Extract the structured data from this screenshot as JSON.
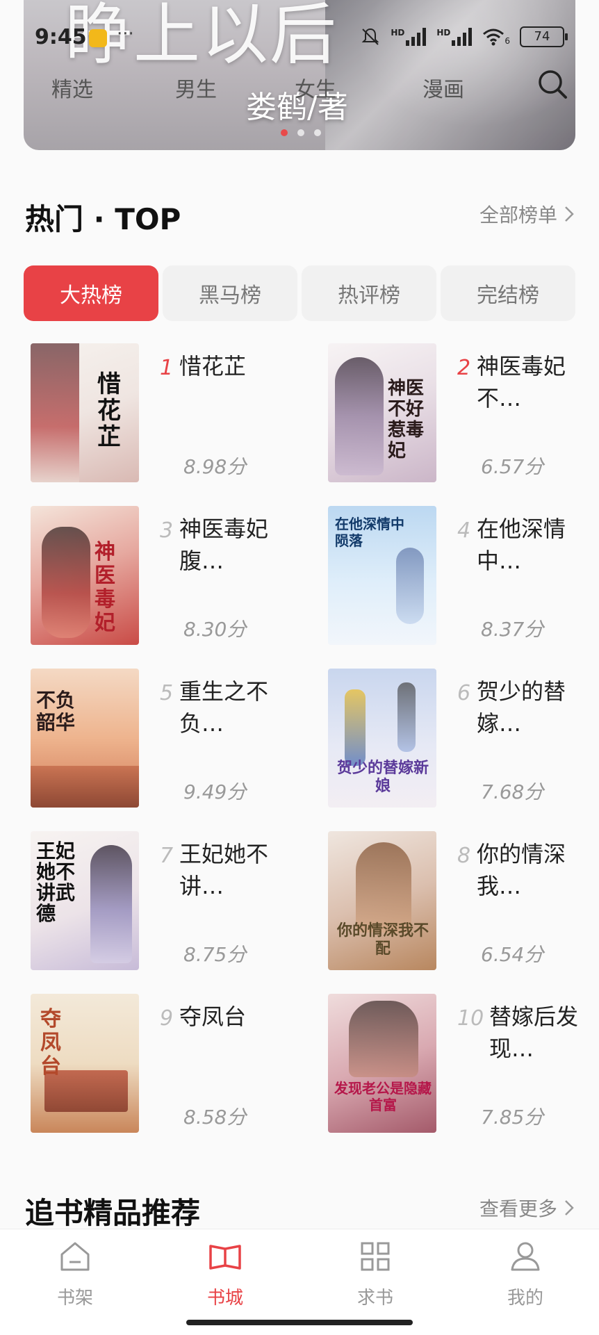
{
  "status_bar": {
    "time": "9:45",
    "more": "···",
    "network_1": "HD",
    "network_2": "HD",
    "wifi_badge": "6",
    "battery": "74"
  },
  "banner": {
    "art_title": "睁上以后",
    "author": "娄鹤/著"
  },
  "top_nav": {
    "tabs": [
      "精选",
      "男生",
      "女生",
      "漫画"
    ],
    "active_index": 0
  },
  "hot_section": {
    "title": "热门 · TOP",
    "link": "全部榜单",
    "tabs": [
      "大热榜",
      "黑马榜",
      "热评榜",
      "完结榜"
    ],
    "active_tab": 0,
    "books": [
      {
        "rank": "1",
        "title": "惜花芷",
        "score": "8.98分",
        "cover_text": "惜花芷"
      },
      {
        "rank": "2",
        "title": "神医毒妃不…",
        "score": "6.57分",
        "cover_text": "神医不好惹毒妃"
      },
      {
        "rank": "3",
        "title": "神医毒妃腹…",
        "score": "8.30分",
        "cover_text": "神医毒妃"
      },
      {
        "rank": "4",
        "title": "在他深情中…",
        "score": "8.37分",
        "cover_text": "在他深情中陨落"
      },
      {
        "rank": "5",
        "title": "重生之不负…",
        "score": "9.49分",
        "cover_text": "不负韶华"
      },
      {
        "rank": "6",
        "title": "贺少的替嫁…",
        "score": "7.68分",
        "cover_text": "贺少的替嫁新娘"
      },
      {
        "rank": "7",
        "title": "王妃她不讲…",
        "score": "8.75分",
        "cover_text": "王妃她不讲武德"
      },
      {
        "rank": "8",
        "title": "你的情深我…",
        "score": "6.54分",
        "cover_text": "你的情深我不配"
      },
      {
        "rank": "9",
        "title": "夺凤台",
        "score": "8.58分",
        "cover_text": "夺凤台"
      },
      {
        "rank": "10",
        "title": "替嫁后发现…",
        "score": "7.85分",
        "cover_text": "发现老公是隐藏首富"
      }
    ]
  },
  "recommend_section": {
    "title": "追书精品推荐",
    "link": "查看更多"
  },
  "tab_bar": {
    "items": [
      {
        "label": "书架",
        "icon": "bookshelf-icon"
      },
      {
        "label": "书城",
        "icon": "open-book-icon"
      },
      {
        "label": "求书",
        "icon": "grid-icon"
      },
      {
        "label": "我的",
        "icon": "profile-icon"
      }
    ],
    "active_index": 1
  },
  "colors": {
    "accent": "#e84246",
    "muted": "#999999"
  }
}
